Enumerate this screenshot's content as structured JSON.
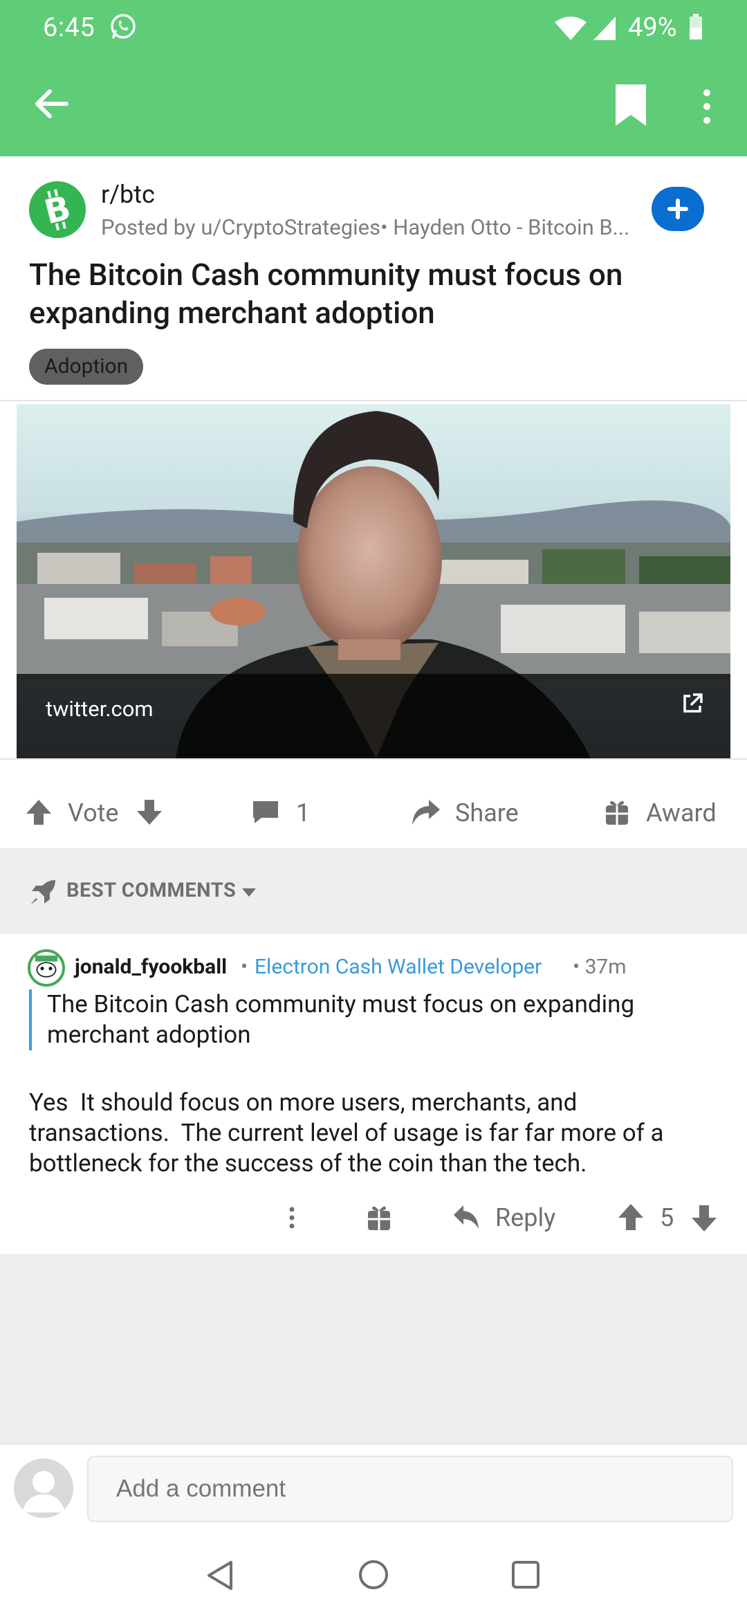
{
  "status_bar": {
    "time": "6:45",
    "battery": "49%"
  },
  "toolbar": {
    "back_icon": "arrow-left-icon",
    "bookmark_icon": "bookmark-icon",
    "more_icon": "more-vertical-icon"
  },
  "post": {
    "subreddit": "r/btc",
    "meta": "Posted by u/CryptoStrategies• Hayden Otto - Bitcoin B...",
    "title": "The Bitcoin Cash community must focus on expanding merchant adoption",
    "flair": "Adoption",
    "link_domain": "twitter.com"
  },
  "actions": {
    "vote_label": "Vote",
    "comment_count": "1",
    "share_label": "Share",
    "award_label": "Award"
  },
  "sort": {
    "label": "BEST COMMENTS"
  },
  "comment": {
    "username": "jonald_fyookball",
    "separator": "•",
    "user_flair": "Electron Cash Wallet Developer",
    "time": "• 37m",
    "quote": "The Bitcoin Cash community must focus on expanding merchant adoption",
    "body": "Yes  It should focus on more users, merchants, and transactions.  The current level of usage is far far more of a bottleneck for the success of the coin than the tech.",
    "reply_label": "Reply",
    "score": "5"
  },
  "composer": {
    "placeholder": "Add a comment"
  },
  "colors": {
    "header_green": "#5fcc77",
    "join_blue": "#0a6dd0",
    "flair_link_blue": "#3a9ad9",
    "bch_green": "#35b452"
  }
}
